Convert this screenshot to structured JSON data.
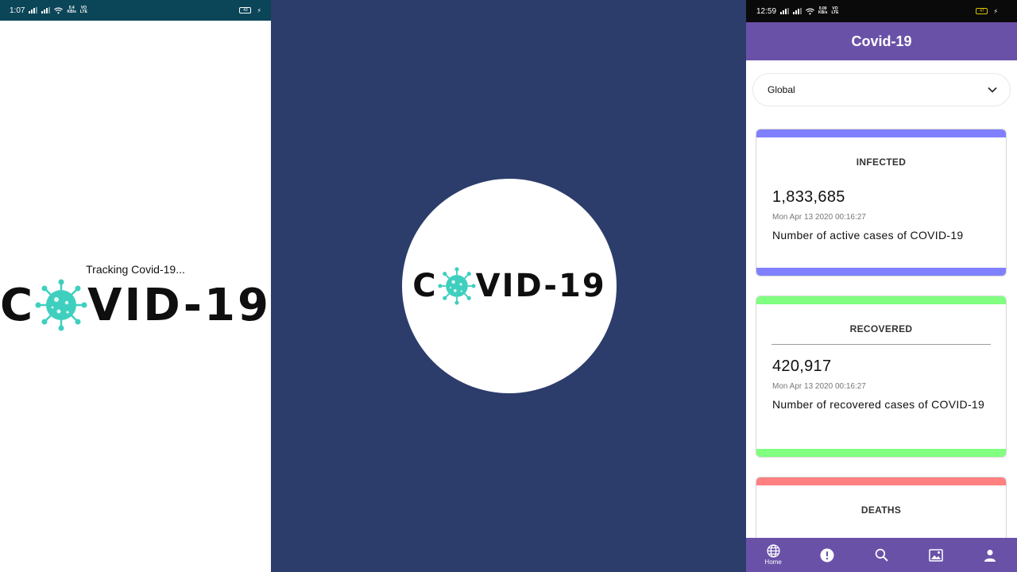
{
  "left_phone": {
    "status": {
      "time": "1:07",
      "net_top": "0.4",
      "net_bottom": "KB/s",
      "volte_top": "VO",
      "volte_bottom": "LTE",
      "battery": "43"
    },
    "loading_text": "Tracking Covid-19...",
    "logo": {
      "left": "C",
      "right": "VID-19"
    }
  },
  "middle": {
    "logo": {
      "left": "C",
      "right": "VID-19"
    },
    "colors": {
      "background": "#2c3c6b",
      "virus": "#3fcfbf"
    }
  },
  "right_phone": {
    "status": {
      "time": "12:59",
      "net_top": "0.00",
      "net_bottom": "KB/s",
      "volte_top": "VO",
      "volte_bottom": "LTE",
      "battery": "47"
    },
    "app_title": "Covid-19",
    "country_select": {
      "value": "Global",
      "icon": "chevron-down-icon"
    },
    "cards": [
      {
        "title": "INFECTED",
        "count": "1,833,685",
        "updated": "Mon Apr 13 2020 00:16:27",
        "description": "Number of active cases of COVID-19",
        "color": "#8080ff"
      },
      {
        "title": "RECOVERED",
        "count": "420,917",
        "updated": "Mon Apr 13 2020 00:16:27",
        "description": "Number of recovered cases of COVID-19",
        "color": "#80ff80"
      },
      {
        "title": "DEATHS",
        "color": "#ff8080"
      }
    ],
    "nav": [
      {
        "label": "Home",
        "icon": "globe-icon"
      },
      {
        "icon": "alert-icon"
      },
      {
        "icon": "search-icon"
      },
      {
        "icon": "image-icon"
      },
      {
        "icon": "person-icon"
      }
    ],
    "colors": {
      "app_bar": "#6a51a8"
    }
  }
}
